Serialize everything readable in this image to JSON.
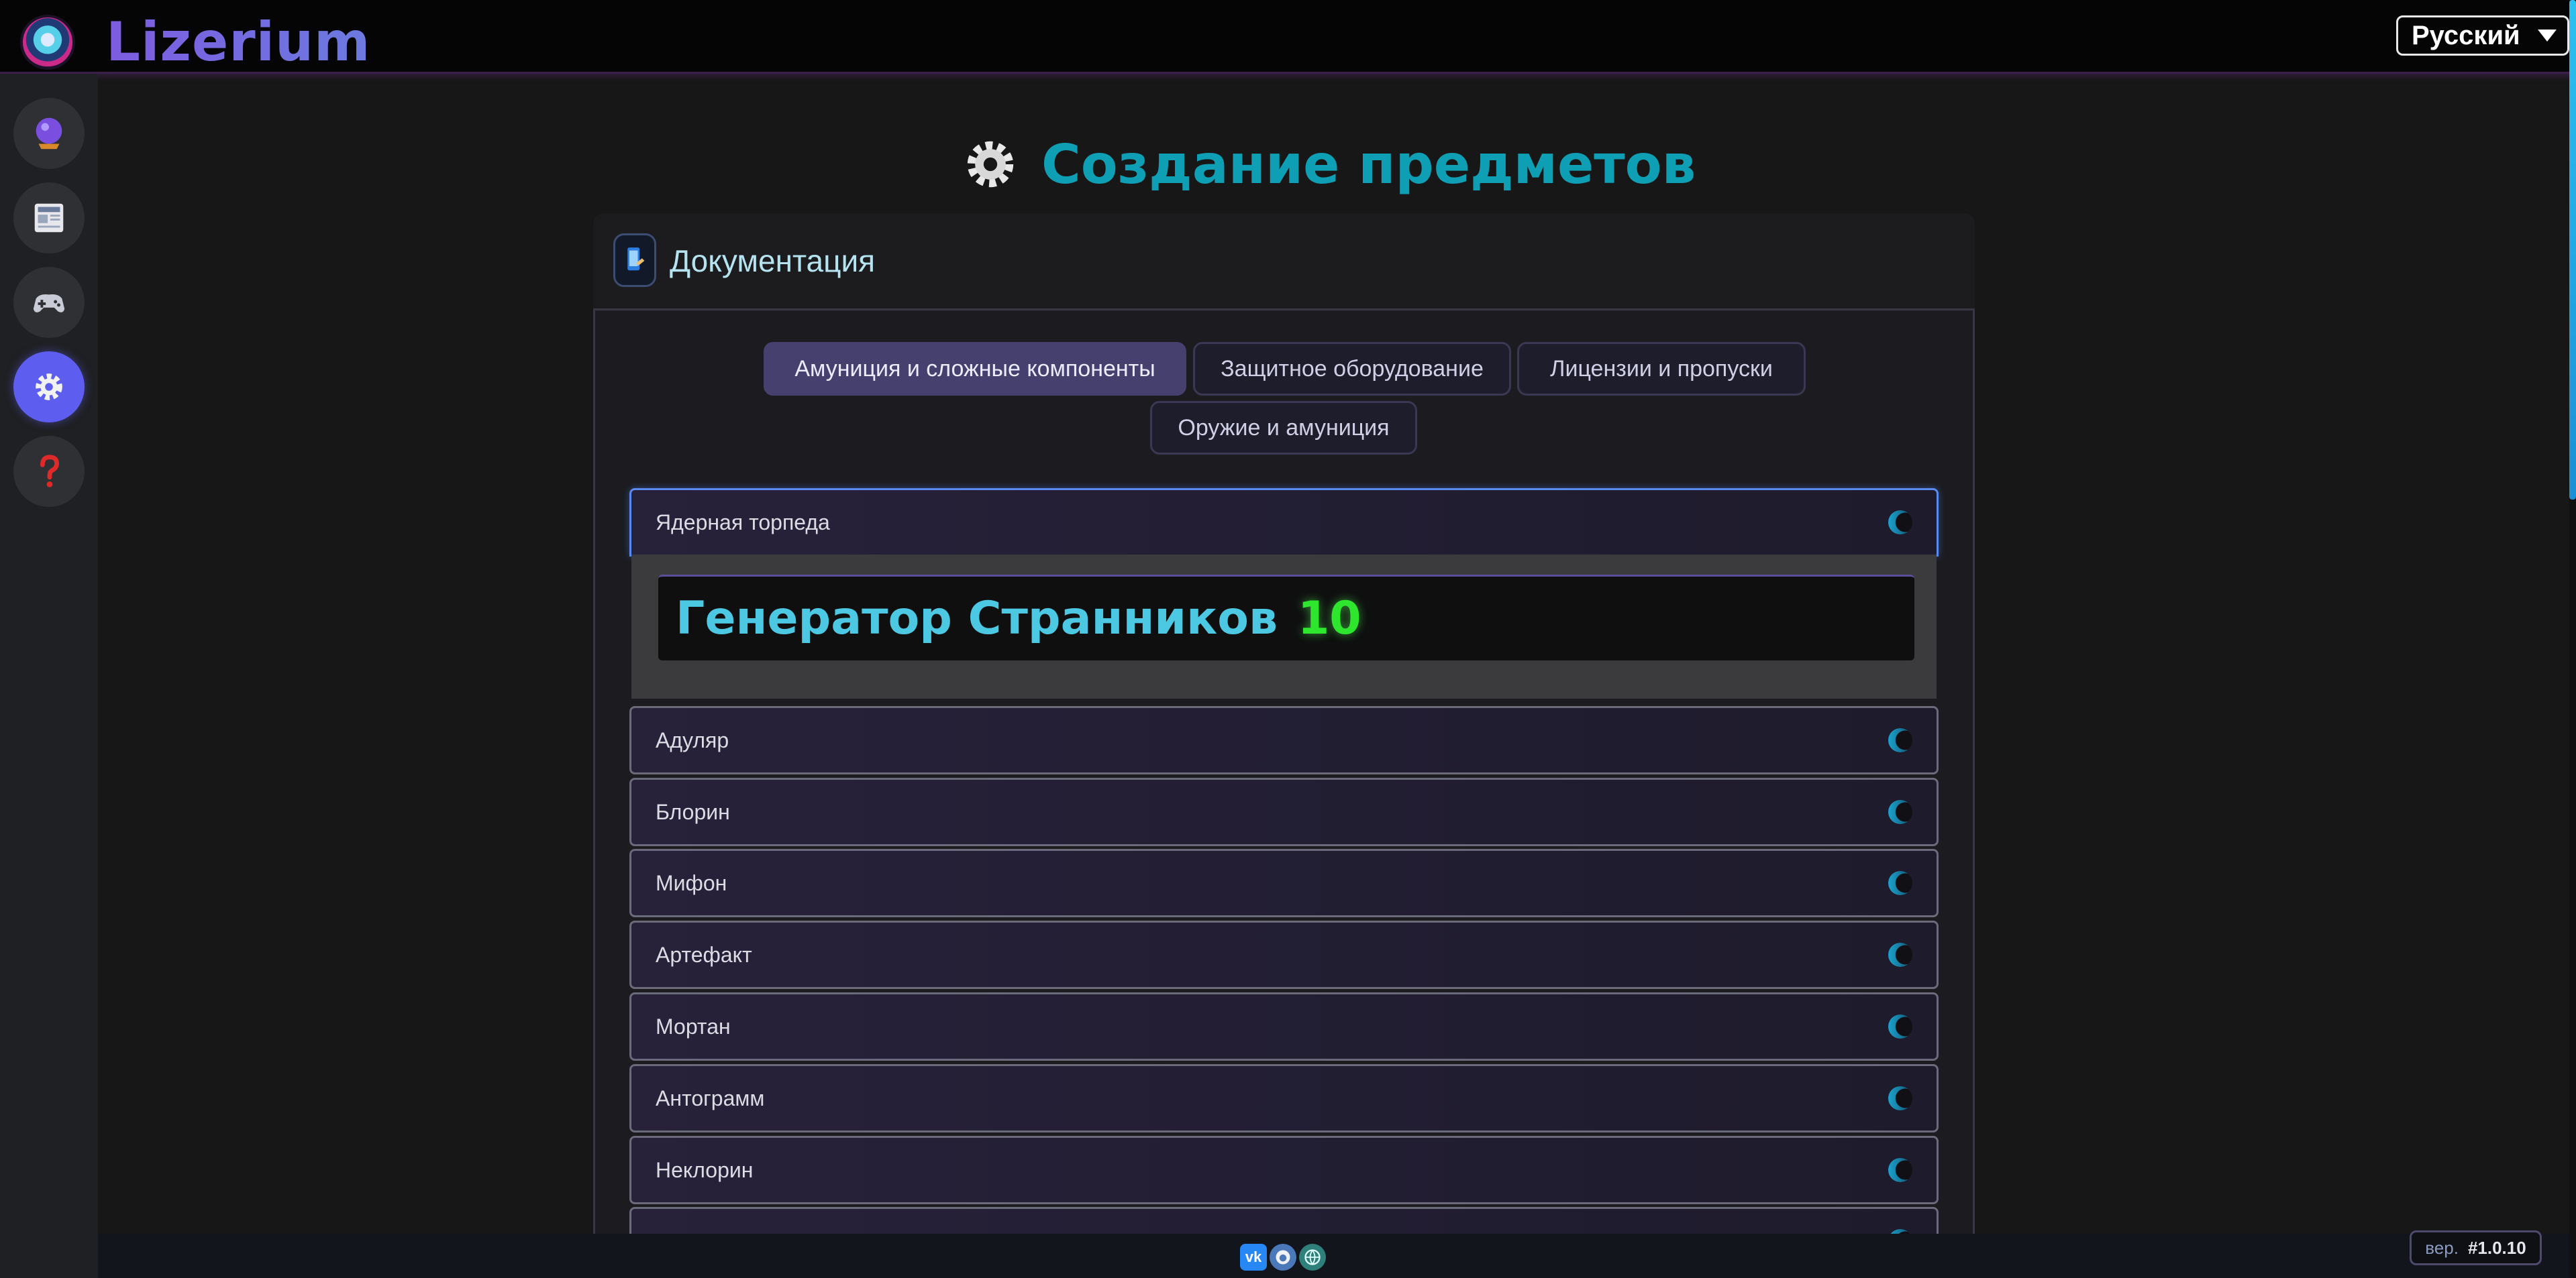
{
  "app": {
    "brand": "Lizerium",
    "language": "Русский"
  },
  "sidebar": {
    "items": [
      {
        "icon": "crystal-ball-icon"
      },
      {
        "icon": "newspaper-icon"
      },
      {
        "icon": "gamepad-icon"
      },
      {
        "icon": "gear-icon",
        "active": true
      },
      {
        "icon": "question-icon"
      }
    ]
  },
  "page": {
    "title": "Создание предметов"
  },
  "panel": {
    "title": "Документация"
  },
  "tabs": [
    {
      "label": "Амуниция и сложные компоненты",
      "active": true
    },
    {
      "label": "Защитное оборудование"
    },
    {
      "label": "Лицензии и пропуски"
    },
    {
      "label": "Оружие и амуниция"
    }
  ],
  "items": [
    {
      "label": "Ядерная торпеда",
      "open": true
    },
    {
      "label": "Адуляр"
    },
    {
      "label": "Блорин"
    },
    {
      "label": "Мифон"
    },
    {
      "label": "Артефакт"
    },
    {
      "label": "Мортан"
    },
    {
      "label": "Антограмм"
    },
    {
      "label": "Неклорин"
    }
  ],
  "recipe": {
    "name": "Генератор Странников",
    "quantity": "10"
  },
  "footer": {
    "socials": [
      "vk-icon",
      "github-icon",
      "globe-icon"
    ],
    "vk_text": "vk",
    "version_label": "вер.",
    "version": "#1.0.10"
  },
  "colors": {
    "accent": "#5d5df0",
    "title": "#0f9fb4",
    "recipe_name": "#4cc8e2",
    "recipe_qty": "#2ee62e"
  }
}
